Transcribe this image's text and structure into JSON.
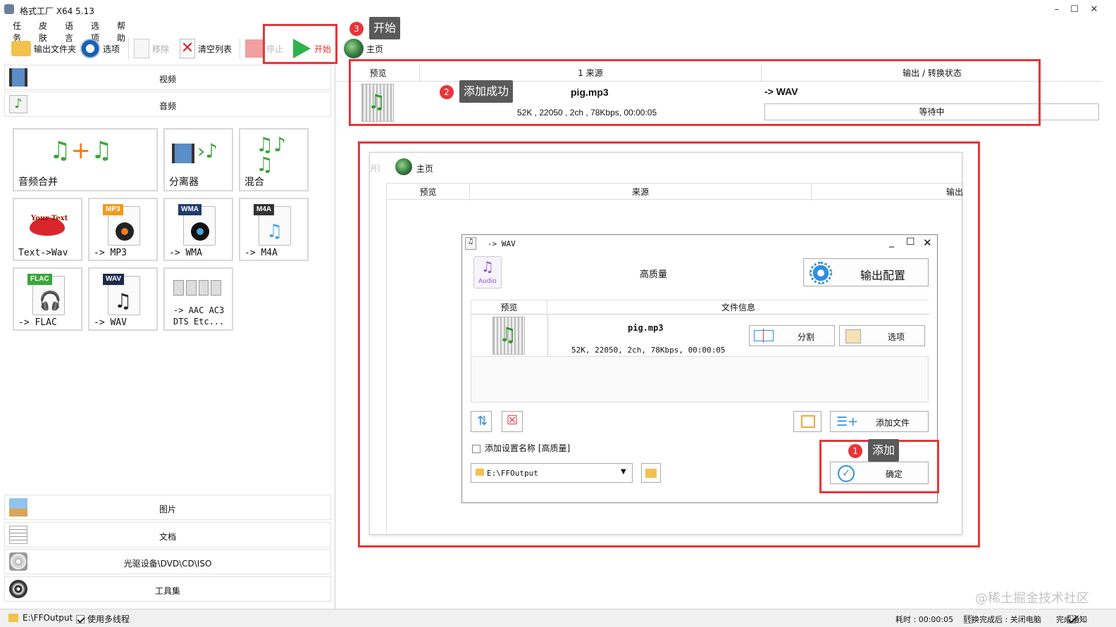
{
  "window": {
    "title": "格式工厂 X64 5.13"
  },
  "menu": [
    "任务",
    "皮肤",
    "语言",
    "选项",
    "帮助"
  ],
  "toolbar": {
    "output_folder": "输出文件夹",
    "options": "选项",
    "remove": "移除",
    "clear_list": "清空列表",
    "stop": "停止",
    "start": "开始",
    "home": "主页"
  },
  "categories": {
    "video": "视频",
    "audio": "音频",
    "image": "图片",
    "document": "文档",
    "optical": "光驱设备\\DVD\\CD\\ISO",
    "tools": "工具集"
  },
  "audio_tiles": [
    {
      "label": "音频合并"
    },
    {
      "label": "分离器"
    },
    {
      "label": "混合"
    },
    {
      "label": "Text->Wav"
    },
    {
      "label": "-> MP3",
      "tag": "MP3"
    },
    {
      "label": "-> WMA",
      "tag": "WMA"
    },
    {
      "label": "-> M4A",
      "tag": "M4A"
    },
    {
      "label": "-> FLAC",
      "tag": "FLAC"
    },
    {
      "label": "-> WAV",
      "tag": "WAV"
    },
    {
      "label": "-> AAC AC3",
      "label2": "DTS Etc..."
    }
  ],
  "tile_art_text": "Your Text",
  "task_list": {
    "headers": {
      "preview": "预览",
      "source": "1 来源",
      "output": "输出 / 转换状态"
    },
    "row": {
      "file": "pig.mp3",
      "info": "52K , 22050 , 2ch , 78Kbps, 00:00:05",
      "target": "-> WAV",
      "status": "等待中"
    }
  },
  "annotations": {
    "a1": {
      "num": "1",
      "text": "添加"
    },
    "a2": {
      "num": "2",
      "text": "添加成功"
    },
    "a3": {
      "num": "3",
      "text": "开始"
    }
  },
  "inset": {
    "partial_start": "开始",
    "home": "主页",
    "headers": {
      "preview": "预览",
      "source": "来源",
      "output": "输出"
    }
  },
  "dialog": {
    "title": "-> WAV",
    "icon_label": "Audio",
    "quality": "高质量",
    "output_config": "输出配置",
    "headers": {
      "preview": "预览",
      "fileinfo": "文件信息"
    },
    "file": {
      "name": "pig.mp3",
      "info": "52K, 22050, 2ch, 78Kbps, 00:00:05"
    },
    "split": "分割",
    "options": "选项",
    "add_file": "添加文件",
    "add_setting_name": "添加设置名称 [高质量]",
    "output_path": "E:\\FFOutput",
    "ok": "确定"
  },
  "statusbar": {
    "path": "E:\\FFOutput",
    "multithread": "使用多线程",
    "elapsed": "耗时 : 00:00:05",
    "after_done": "转换完成后 : 关闭电脑",
    "notify": "完成通知"
  },
  "watermark": "@稀土掘金技术社区",
  "colors": {
    "accent_red": "#e8353a",
    "start_green": "#2fb34a",
    "tooltip_bg": "#5a5a5a"
  }
}
